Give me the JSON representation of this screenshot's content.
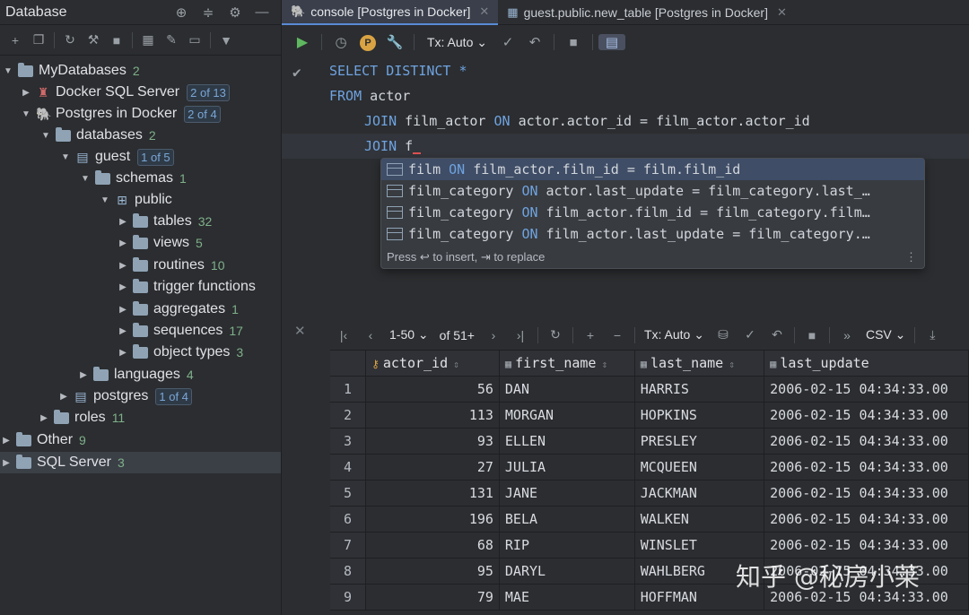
{
  "left_panel": {
    "title": "Database",
    "tree": [
      {
        "label": "MyDatabases",
        "count": "2",
        "badge": ""
      },
      {
        "label": "Docker SQL Server",
        "count": "",
        "badge": "2 of 13"
      },
      {
        "label": "Postgres in Docker",
        "count": "",
        "badge": "2 of 4"
      },
      {
        "label": "databases",
        "count": "2",
        "badge": ""
      },
      {
        "label": "guest",
        "count": "",
        "badge": "1 of 5"
      },
      {
        "label": "schemas",
        "count": "1",
        "badge": ""
      },
      {
        "label": "public",
        "count": "",
        "badge": ""
      },
      {
        "label": "tables",
        "count": "32",
        "badge": ""
      },
      {
        "label": "views",
        "count": "5",
        "badge": ""
      },
      {
        "label": "routines",
        "count": "10",
        "badge": ""
      },
      {
        "label": "trigger functions",
        "count": "",
        "badge": ""
      },
      {
        "label": "aggregates",
        "count": "1",
        "badge": ""
      },
      {
        "label": "sequences",
        "count": "17",
        "badge": ""
      },
      {
        "label": "object types",
        "count": "3",
        "badge": ""
      },
      {
        "label": "languages",
        "count": "4",
        "badge": ""
      },
      {
        "label": "postgres",
        "count": "",
        "badge": "1 of 4"
      },
      {
        "label": "roles",
        "count": "11",
        "badge": ""
      },
      {
        "label": "Other",
        "count": "9",
        "badge": ""
      },
      {
        "label": "SQL Server",
        "count": "3",
        "badge": ""
      }
    ]
  },
  "tabs": [
    {
      "label": "console [Postgres in Docker]"
    },
    {
      "label": "guest.public.new_table [Postgres in Docker]"
    }
  ],
  "editor_toolbar": {
    "tx_label": "Tx: Auto",
    "profile_letter": "P"
  },
  "editor": {
    "line1_kw1": "SELECT",
    "line1_kw2": "DISTINCT",
    "line1_rest": " *",
    "line2_kw": "FROM",
    "line2_rest": " actor",
    "line3_kw1": "JOIN",
    "line3_a": " film_actor ",
    "line3_kw2": "ON",
    "line3_b": " actor.actor_id = film_actor.actor_id",
    "line4_kw": "JOIN",
    "line4_rest": " f"
  },
  "completion": {
    "items": [
      {
        "t1": "film",
        "kw": "ON",
        "t2": "film_actor.film_id = film.film_id"
      },
      {
        "t1": "film_category",
        "kw": "ON",
        "t2": "actor.last_update = film_category.last_…"
      },
      {
        "t1": "film_category",
        "kw": "ON",
        "t2": "film_actor.film_id = film_category.film…"
      },
      {
        "t1": "film_category",
        "kw": "ON",
        "t2": "film_actor.last_update = film_category.…"
      }
    ],
    "footer": "Press ↩ to insert, ⇥ to replace"
  },
  "results_toolbar": {
    "range": "1-50",
    "total": "of 51+",
    "tx_label": "Tx: Auto",
    "export_format": "CSV"
  },
  "results": {
    "columns": [
      "actor_id",
      "first_name",
      "last_name",
      "last_update"
    ],
    "rows": [
      [
        "1",
        "56",
        "DAN",
        "HARRIS",
        "2006-02-15 04:34:33.00"
      ],
      [
        "2",
        "113",
        "MORGAN",
        "HOPKINS",
        "2006-02-15 04:34:33.00"
      ],
      [
        "3",
        "93",
        "ELLEN",
        "PRESLEY",
        "2006-02-15 04:34:33.00"
      ],
      [
        "4",
        "27",
        "JULIA",
        "MCQUEEN",
        "2006-02-15 04:34:33.00"
      ],
      [
        "5",
        "131",
        "JANE",
        "JACKMAN",
        "2006-02-15 04:34:33.00"
      ],
      [
        "6",
        "196",
        "BELA",
        "WALKEN",
        "2006-02-15 04:34:33.00"
      ],
      [
        "7",
        "68",
        "RIP",
        "WINSLET",
        "2006-02-15 04:34:33.00"
      ],
      [
        "8",
        "95",
        "DARYL",
        "WAHLBERG",
        "2006-02-15 04:34:33.00"
      ],
      [
        "9",
        "79",
        "MAE",
        "HOFFMAN",
        "2006-02-15 04:34:33.00"
      ]
    ]
  },
  "watermark": "知乎 @秘房小莱"
}
